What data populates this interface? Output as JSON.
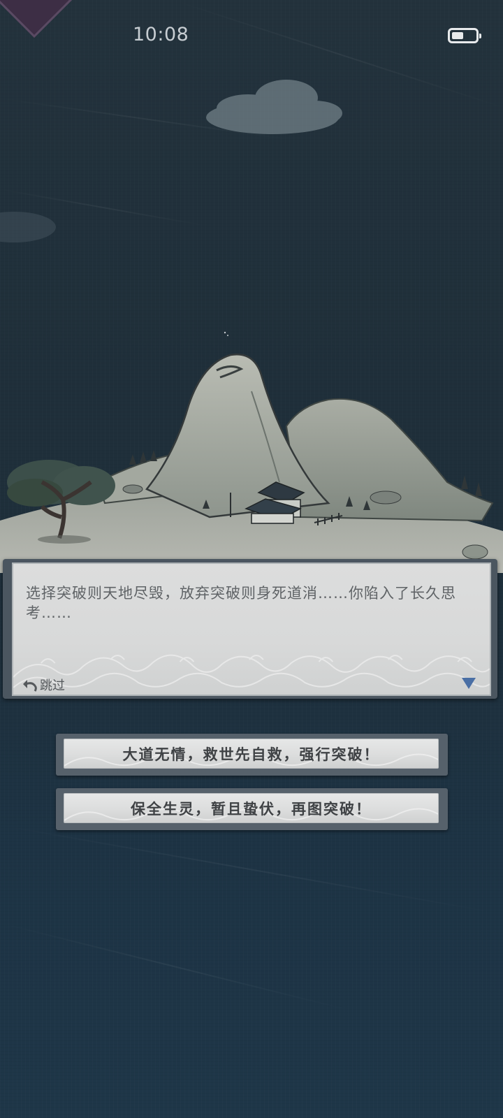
{
  "status_bar": {
    "time": "10:08",
    "battery_level": 0.5
  },
  "dialog": {
    "text": "选择突破则天地尽毁，放弃突破则身死道消……你陷入了长久思考……",
    "skip_label": "跳过",
    "skip_icon": "undo-arrow-icon",
    "more_icon": "down-triangle-icon"
  },
  "choices": [
    {
      "label": "大道无情，救世先自救，强行突破！"
    },
    {
      "label": "保全生灵，暂且蛰伏，再图突破！"
    }
  ],
  "colors": {
    "background": "#1f2f3a",
    "panel": "#dcdddd",
    "panel_frame": "#4b5660",
    "text": "#5f6366",
    "arrow": "#4a6fa5"
  }
}
